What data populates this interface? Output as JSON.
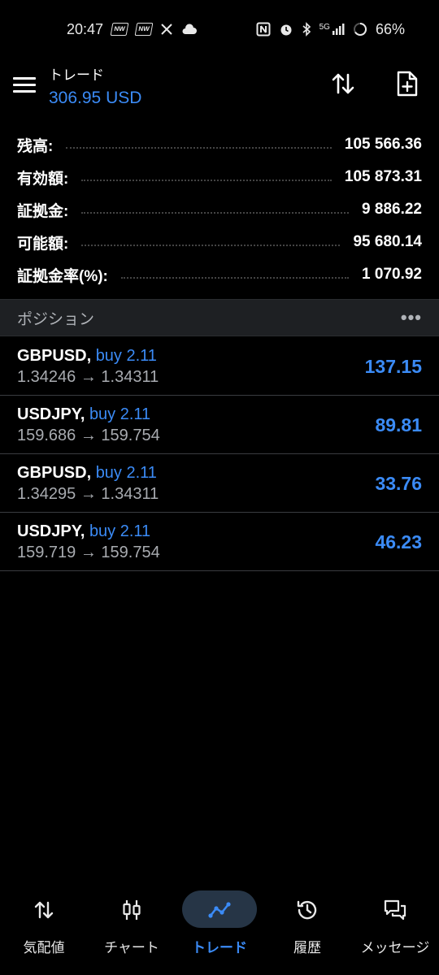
{
  "status_bar": {
    "time": "20:47",
    "network": "5G",
    "battery": "66%"
  },
  "header": {
    "title": "トレード",
    "balance": "306.95 USD"
  },
  "summary": [
    {
      "label": "残高:",
      "value": "105 566.36"
    },
    {
      "label": "有効額:",
      "value": "105 873.31"
    },
    {
      "label": "証拠金:",
      "value": "9 886.22"
    },
    {
      "label": "可能額:",
      "value": "95 680.14"
    },
    {
      "label": "証拠金率(%):",
      "value": "1 070.92"
    }
  ],
  "positions_section": {
    "title": "ポジション",
    "more": "•••"
  },
  "positions": [
    {
      "symbol": "GBPUSD,",
      "side": "buy 2.11",
      "prices": "1.34246 → 1.34311",
      "profit": "137.15"
    },
    {
      "symbol": "USDJPY,",
      "side": "buy 2.11",
      "prices": "159.686 → 159.754",
      "profit": "89.81"
    },
    {
      "symbol": "GBPUSD,",
      "side": "buy 2.11",
      "prices": "1.34295 → 1.34311",
      "profit": "33.76"
    },
    {
      "symbol": "USDJPY,",
      "side": "buy 2.11",
      "prices": "159.719 → 159.754",
      "profit": "46.23"
    }
  ],
  "bottom_nav": [
    {
      "label": "気配値",
      "icon": "quotes-arrows-icon"
    },
    {
      "label": "チャート",
      "icon": "candlestick-icon"
    },
    {
      "label": "トレード",
      "icon": "trade-line-icon",
      "active": true
    },
    {
      "label": "履歴",
      "icon": "history-clock-icon"
    },
    {
      "label": "メッセージ",
      "icon": "chat-bubbles-icon"
    }
  ],
  "colors": {
    "accent": "#3b8bf6",
    "background": "#000000",
    "section_bg": "#1e2023"
  }
}
